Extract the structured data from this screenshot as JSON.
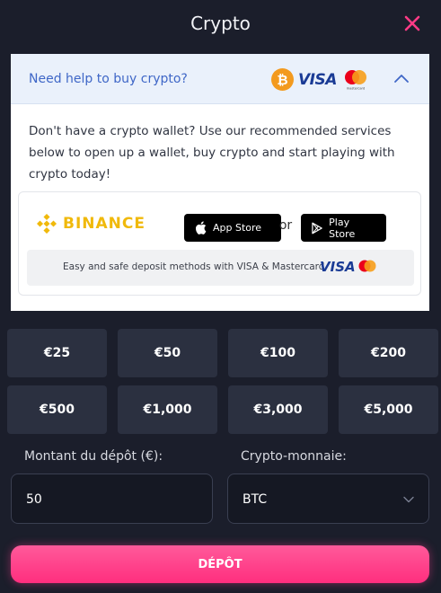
{
  "header": {
    "title": "Crypto",
    "close_icon": "close-icon",
    "close_color": "#ff3b86"
  },
  "help": {
    "question": "Need help to buy crypto?",
    "btc_glyph": "₿",
    "visa": "VISA",
    "mastercard_text": "mastercard",
    "expanded": true,
    "description": "Don't have a crypto wallet? Use our recommended services below to open up a wallet, buy crypto and start playing with crypto today!",
    "provider": "BINANCE",
    "app_store": "App Store",
    "or": "or",
    "play_store": "Play Store",
    "safe_text": "Easy and safe deposit methods with VISA & Mastercard",
    "safe_visa": "VISA"
  },
  "amounts": [
    "€25",
    "€50",
    "€100",
    "€200",
    "€500",
    "€1,000",
    "€3,000",
    "€5,000"
  ],
  "form": {
    "amount_label": "Montant du dépôt (€):",
    "amount_value": "50",
    "currency_label": "Crypto-monnaie:",
    "currency_value": "BTC"
  },
  "deposit_label": "DÉPÔT",
  "colors": {
    "background": "#1b1e2b",
    "accent": "#ff2e7e",
    "binance": "#f0b90b",
    "btc": "#f39a1e"
  }
}
